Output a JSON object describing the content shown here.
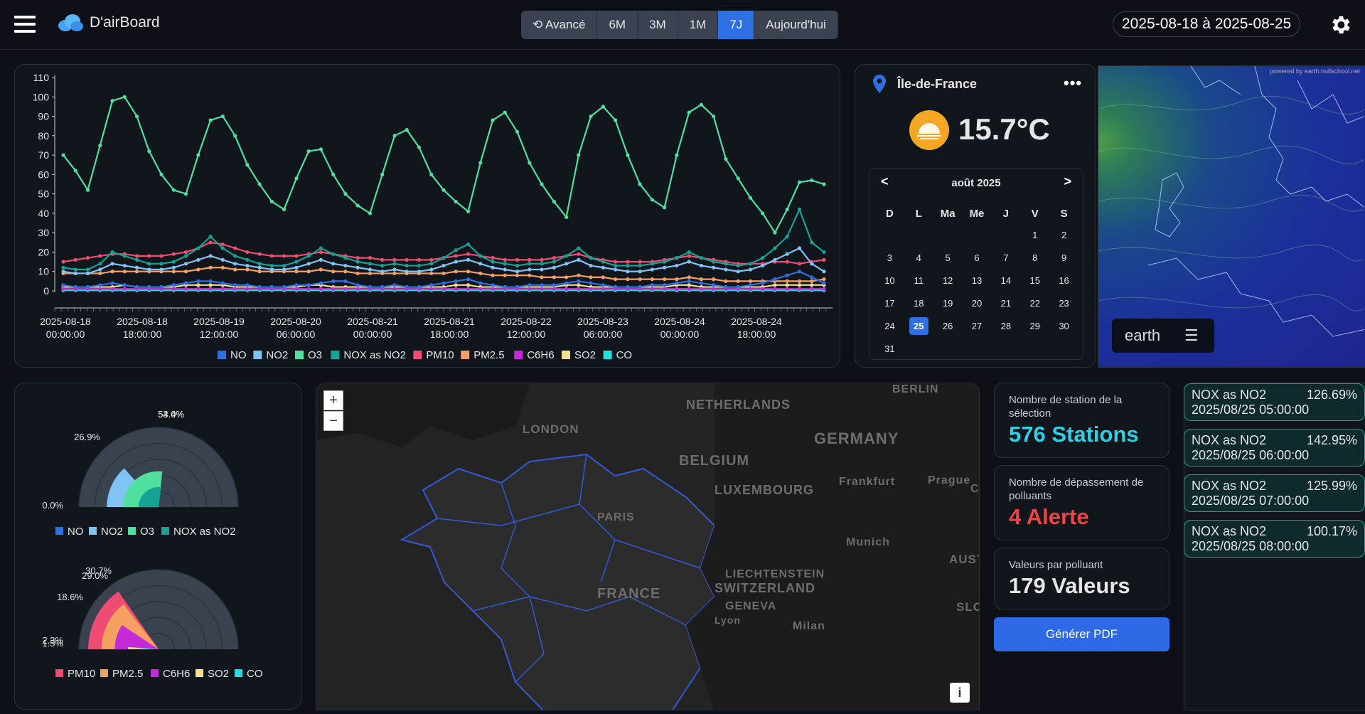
{
  "app": {
    "title": "D'airBoard"
  },
  "ranges": {
    "items": [
      "Avancé",
      "6M",
      "3M",
      "1M",
      "7J",
      "Aujourd'hui"
    ],
    "active": "7J"
  },
  "date_range": "2025-08-18 à 2025-08-25",
  "chart_data": {
    "type": "line",
    "ylim": [
      0,
      110
    ],
    "y_ticks": [
      "110",
      "100",
      "90",
      "80",
      "70",
      "60",
      "50",
      "40",
      "30",
      "20",
      "10",
      "0"
    ],
    "x_ticks": [
      [
        "2025-08-18",
        "00:00:00"
      ],
      [
        "2025-08-18",
        "18:00:00"
      ],
      [
        "2025-08-19",
        "12:00:00"
      ],
      [
        "2025-08-20",
        "06:00:00"
      ],
      [
        "2025-08-21",
        "00:00:00"
      ],
      [
        "2025-08-21",
        "18:00:00"
      ],
      [
        "2025-08-22",
        "12:00:00"
      ],
      [
        "2025-08-23",
        "06:00:00"
      ],
      [
        "2025-08-24",
        "00:00:00"
      ],
      [
        "2025-08-24",
        "18:00:00"
      ]
    ],
    "series": [
      {
        "name": "NO",
        "color": "#2f6fe4",
        "values": [
          3,
          2,
          2,
          3,
          4,
          3,
          2,
          2,
          2,
          3,
          4,
          5,
          5,
          4,
          3,
          3,
          2,
          2,
          2,
          3,
          3,
          4,
          5,
          5,
          3,
          2,
          2,
          3,
          2,
          2,
          3,
          4,
          5,
          6,
          4,
          3,
          2,
          2,
          3,
          3,
          3,
          4,
          5,
          4,
          3,
          2,
          2,
          2,
          3,
          3,
          4,
          5,
          4,
          3,
          2,
          2,
          3,
          4,
          6,
          8,
          10,
          7,
          4
        ]
      },
      {
        "name": "NO2",
        "color": "#7fc4f5",
        "values": [
          10,
          9,
          9,
          11,
          14,
          13,
          12,
          11,
          11,
          12,
          14,
          16,
          18,
          16,
          14,
          13,
          12,
          11,
          11,
          12,
          14,
          16,
          14,
          13,
          12,
          11,
          10,
          11,
          10,
          10,
          11,
          13,
          15,
          16,
          14,
          12,
          11,
          10,
          11,
          11,
          12,
          14,
          16,
          13,
          12,
          11,
          10,
          10,
          11,
          12,
          13,
          15,
          13,
          12,
          11,
          10,
          11,
          13,
          16,
          19,
          22,
          14,
          10
        ]
      },
      {
        "name": "O3",
        "color": "#4fe0a0",
        "values": [
          70,
          62,
          52,
          75,
          98,
          100,
          90,
          72,
          60,
          52,
          50,
          70,
          88,
          90,
          80,
          65,
          55,
          46,
          42,
          58,
          72,
          73,
          60,
          50,
          44,
          40,
          60,
          80,
          83,
          74,
          60,
          52,
          46,
          41,
          66,
          88,
          92,
          82,
          66,
          55,
          46,
          38,
          70,
          90,
          95,
          88,
          70,
          55,
          47,
          43,
          70,
          92,
          96,
          90,
          68,
          58,
          48,
          40,
          30,
          42,
          56,
          57,
          55
        ]
      },
      {
        "name": "NOX as NO2",
        "color": "#14a394",
        "values": [
          12,
          11,
          11,
          14,
          20,
          18,
          16,
          14,
          14,
          15,
          18,
          22,
          28,
          22,
          18,
          16,
          14,
          13,
          13,
          15,
          18,
          22,
          19,
          17,
          15,
          14,
          13,
          14,
          13,
          13,
          14,
          17,
          21,
          24,
          18,
          15,
          14,
          13,
          14,
          14,
          15,
          18,
          22,
          17,
          15,
          13,
          13,
          13,
          14,
          15,
          17,
          20,
          17,
          15,
          14,
          13,
          14,
          17,
          22,
          28,
          42,
          25,
          20
        ]
      },
      {
        "name": "PM10",
        "color": "#ef4b73",
        "values": [
          15,
          16,
          17,
          18,
          19,
          19,
          18,
          18,
          18,
          19,
          20,
          22,
          25,
          24,
          22,
          20,
          19,
          18,
          18,
          18,
          19,
          20,
          19,
          18,
          17,
          17,
          16,
          16,
          16,
          16,
          16,
          17,
          18,
          19,
          18,
          17,
          16,
          16,
          16,
          16,
          17,
          18,
          19,
          17,
          16,
          15,
          15,
          15,
          15,
          16,
          17,
          18,
          17,
          16,
          15,
          14,
          14,
          14,
          15,
          15,
          14,
          15,
          16
        ]
      },
      {
        "name": "PM2.5",
        "color": "#f3a060",
        "values": [
          9,
          9,
          9,
          9,
          10,
          10,
          10,
          10,
          10,
          10,
          10,
          11,
          12,
          12,
          11,
          11,
          10,
          10,
          10,
          10,
          10,
          11,
          10,
          10,
          9,
          9,
          9,
          9,
          9,
          9,
          9,
          9,
          10,
          10,
          9,
          8,
          8,
          8,
          8,
          7,
          7,
          7,
          8,
          7,
          7,
          6,
          6,
          6,
          6,
          6,
          6,
          7,
          6,
          6,
          5,
          5,
          5,
          5,
          5,
          5,
          5,
          5,
          6
        ]
      },
      {
        "name": "C6H6",
        "color": "#c42ad8",
        "values": [
          1,
          1,
          1,
          1,
          1,
          1,
          1,
          1,
          1,
          1,
          1,
          1,
          1,
          1,
          1,
          1,
          1,
          1,
          1,
          1,
          1,
          1,
          1,
          1,
          1,
          1,
          1,
          1,
          1,
          1,
          1,
          1,
          1,
          1,
          1,
          1,
          1,
          1,
          1,
          1,
          1,
          1,
          1,
          1,
          1,
          1,
          1,
          1,
          1,
          1,
          1,
          1,
          1,
          1,
          1,
          1,
          1,
          1,
          1,
          1,
          1,
          1,
          1
        ]
      },
      {
        "name": "SO2",
        "color": "#f5e08f",
        "values": [
          2,
          2,
          2,
          2,
          2,
          3,
          2,
          2,
          2,
          2,
          3,
          3,
          3,
          3,
          2,
          2,
          2,
          2,
          2,
          2,
          3,
          3,
          2,
          2,
          2,
          2,
          2,
          2,
          2,
          2,
          2,
          2,
          3,
          3,
          2,
          2,
          2,
          2,
          2,
          2,
          2,
          3,
          3,
          2,
          2,
          2,
          2,
          2,
          2,
          2,
          3,
          3,
          2,
          2,
          2,
          2,
          2,
          2,
          3,
          3,
          3,
          3,
          3
        ]
      },
      {
        "name": "CO",
        "color": "#1ee2e2",
        "values": [
          0.3,
          0.3,
          0.3,
          0.3,
          0.3,
          0.3,
          0.3,
          0.3,
          0.3,
          0.3,
          0.3,
          0.3,
          0.3,
          0.3,
          0.3,
          0.3,
          0.3,
          0.3,
          0.3,
          0.3,
          0.3,
          0.3,
          0.3,
          0.3,
          0.3,
          0.3,
          0.3,
          0.3,
          0.3,
          0.3,
          0.3,
          0.3,
          0.3,
          0.3,
          0.3,
          0.3,
          0.3,
          0.3,
          0.3,
          0.3,
          0.3,
          0.3,
          0.3,
          0.3,
          0.3,
          0.3,
          0.3,
          0.3,
          0.3,
          0.3,
          0.3,
          0.3,
          0.3,
          0.3,
          0.3,
          0.3,
          0.3,
          0.3,
          0.3,
          0.3,
          0.3,
          0.3,
          0.3
        ]
      }
    ]
  },
  "weather": {
    "location": "Île-de-France",
    "temperature": "15.7°C"
  },
  "calendar": {
    "month": "août 2025",
    "prev": "<",
    "next": ">",
    "day_headers": [
      "D",
      "L",
      "Ma",
      "Me",
      "J",
      "V",
      "S"
    ],
    "leading_blanks": 5,
    "days": 31,
    "selected": 25
  },
  "earth": {
    "label": "earth",
    "credit": "powered by earth.nullschool.net"
  },
  "gauges": {
    "top": {
      "legend": [
        {
          "name": "NO",
          "color": "#2f6fe4"
        },
        {
          "name": "NO2",
          "color": "#7fc4f5"
        },
        {
          "name": "O3",
          "color": "#4fe0a0"
        },
        {
          "name": "NOX as NO2",
          "color": "#14a394"
        }
      ],
      "labels": [
        "0.0%",
        "26.9%",
        "53.4%",
        "54.0%"
      ],
      "values": [
        0.0,
        26.9,
        53.4,
        54.0
      ]
    },
    "bottom": {
      "legend": [
        {
          "name": "PM10",
          "color": "#ef4b73"
        },
        {
          "name": "PM2.5",
          "color": "#f3a060"
        },
        {
          "name": "C6H6",
          "color": "#c42ad8"
        },
        {
          "name": "SO2",
          "color": "#f5e08f"
        },
        {
          "name": "CO",
          "color": "#1ee2e2"
        }
      ],
      "labels": [
        "30.7%",
        "29.0%",
        "18.6%",
        "2.3%",
        "1.5%"
      ],
      "values": [
        30.7,
        29.0,
        18.6,
        2.3,
        1.5
      ]
    }
  },
  "map": {
    "zoom_in": "+",
    "zoom_out": "−",
    "info": "i",
    "labels": [
      "NETHERLANDS",
      "BERLIN",
      "LONDON",
      "GERMANY",
      "BELGIUM",
      "Frankfurt",
      "Prague",
      "LUXEMBOURG",
      "PARIS",
      "Munich",
      "AUSTR",
      "LIECHTENSTEIN",
      "SWITZERLAND",
      "FRANCE",
      "GENEVA",
      "SLOV",
      "Lyon",
      "Milan",
      "CZ"
    ]
  },
  "stats": [
    {
      "label": "Nombre de station de la sélection",
      "value": "576 Stations",
      "color": "#2fd0e6"
    },
    {
      "label": "Nombre de dépassement de polluants",
      "value": "4 Alerte",
      "color": "#ef4444"
    },
    {
      "label": "Valeurs par polluant",
      "value": "179 Valeurs",
      "color": "#e6e6e6"
    }
  ],
  "pdf_button": "Générer PDF",
  "alerts": [
    {
      "pollutant": "NOX as NO2",
      "pct": "126.69%",
      "date": "2025/08/25 05:00:00"
    },
    {
      "pollutant": "NOX as NO2",
      "pct": "142.95%",
      "date": "2025/08/25 06:00:00"
    },
    {
      "pollutant": "NOX as NO2",
      "pct": "125.99%",
      "date": "2025/08/25 07:00:00"
    },
    {
      "pollutant": "NOX as NO2",
      "pct": "100.17%",
      "date": "2025/08/25 08:00:00"
    }
  ]
}
